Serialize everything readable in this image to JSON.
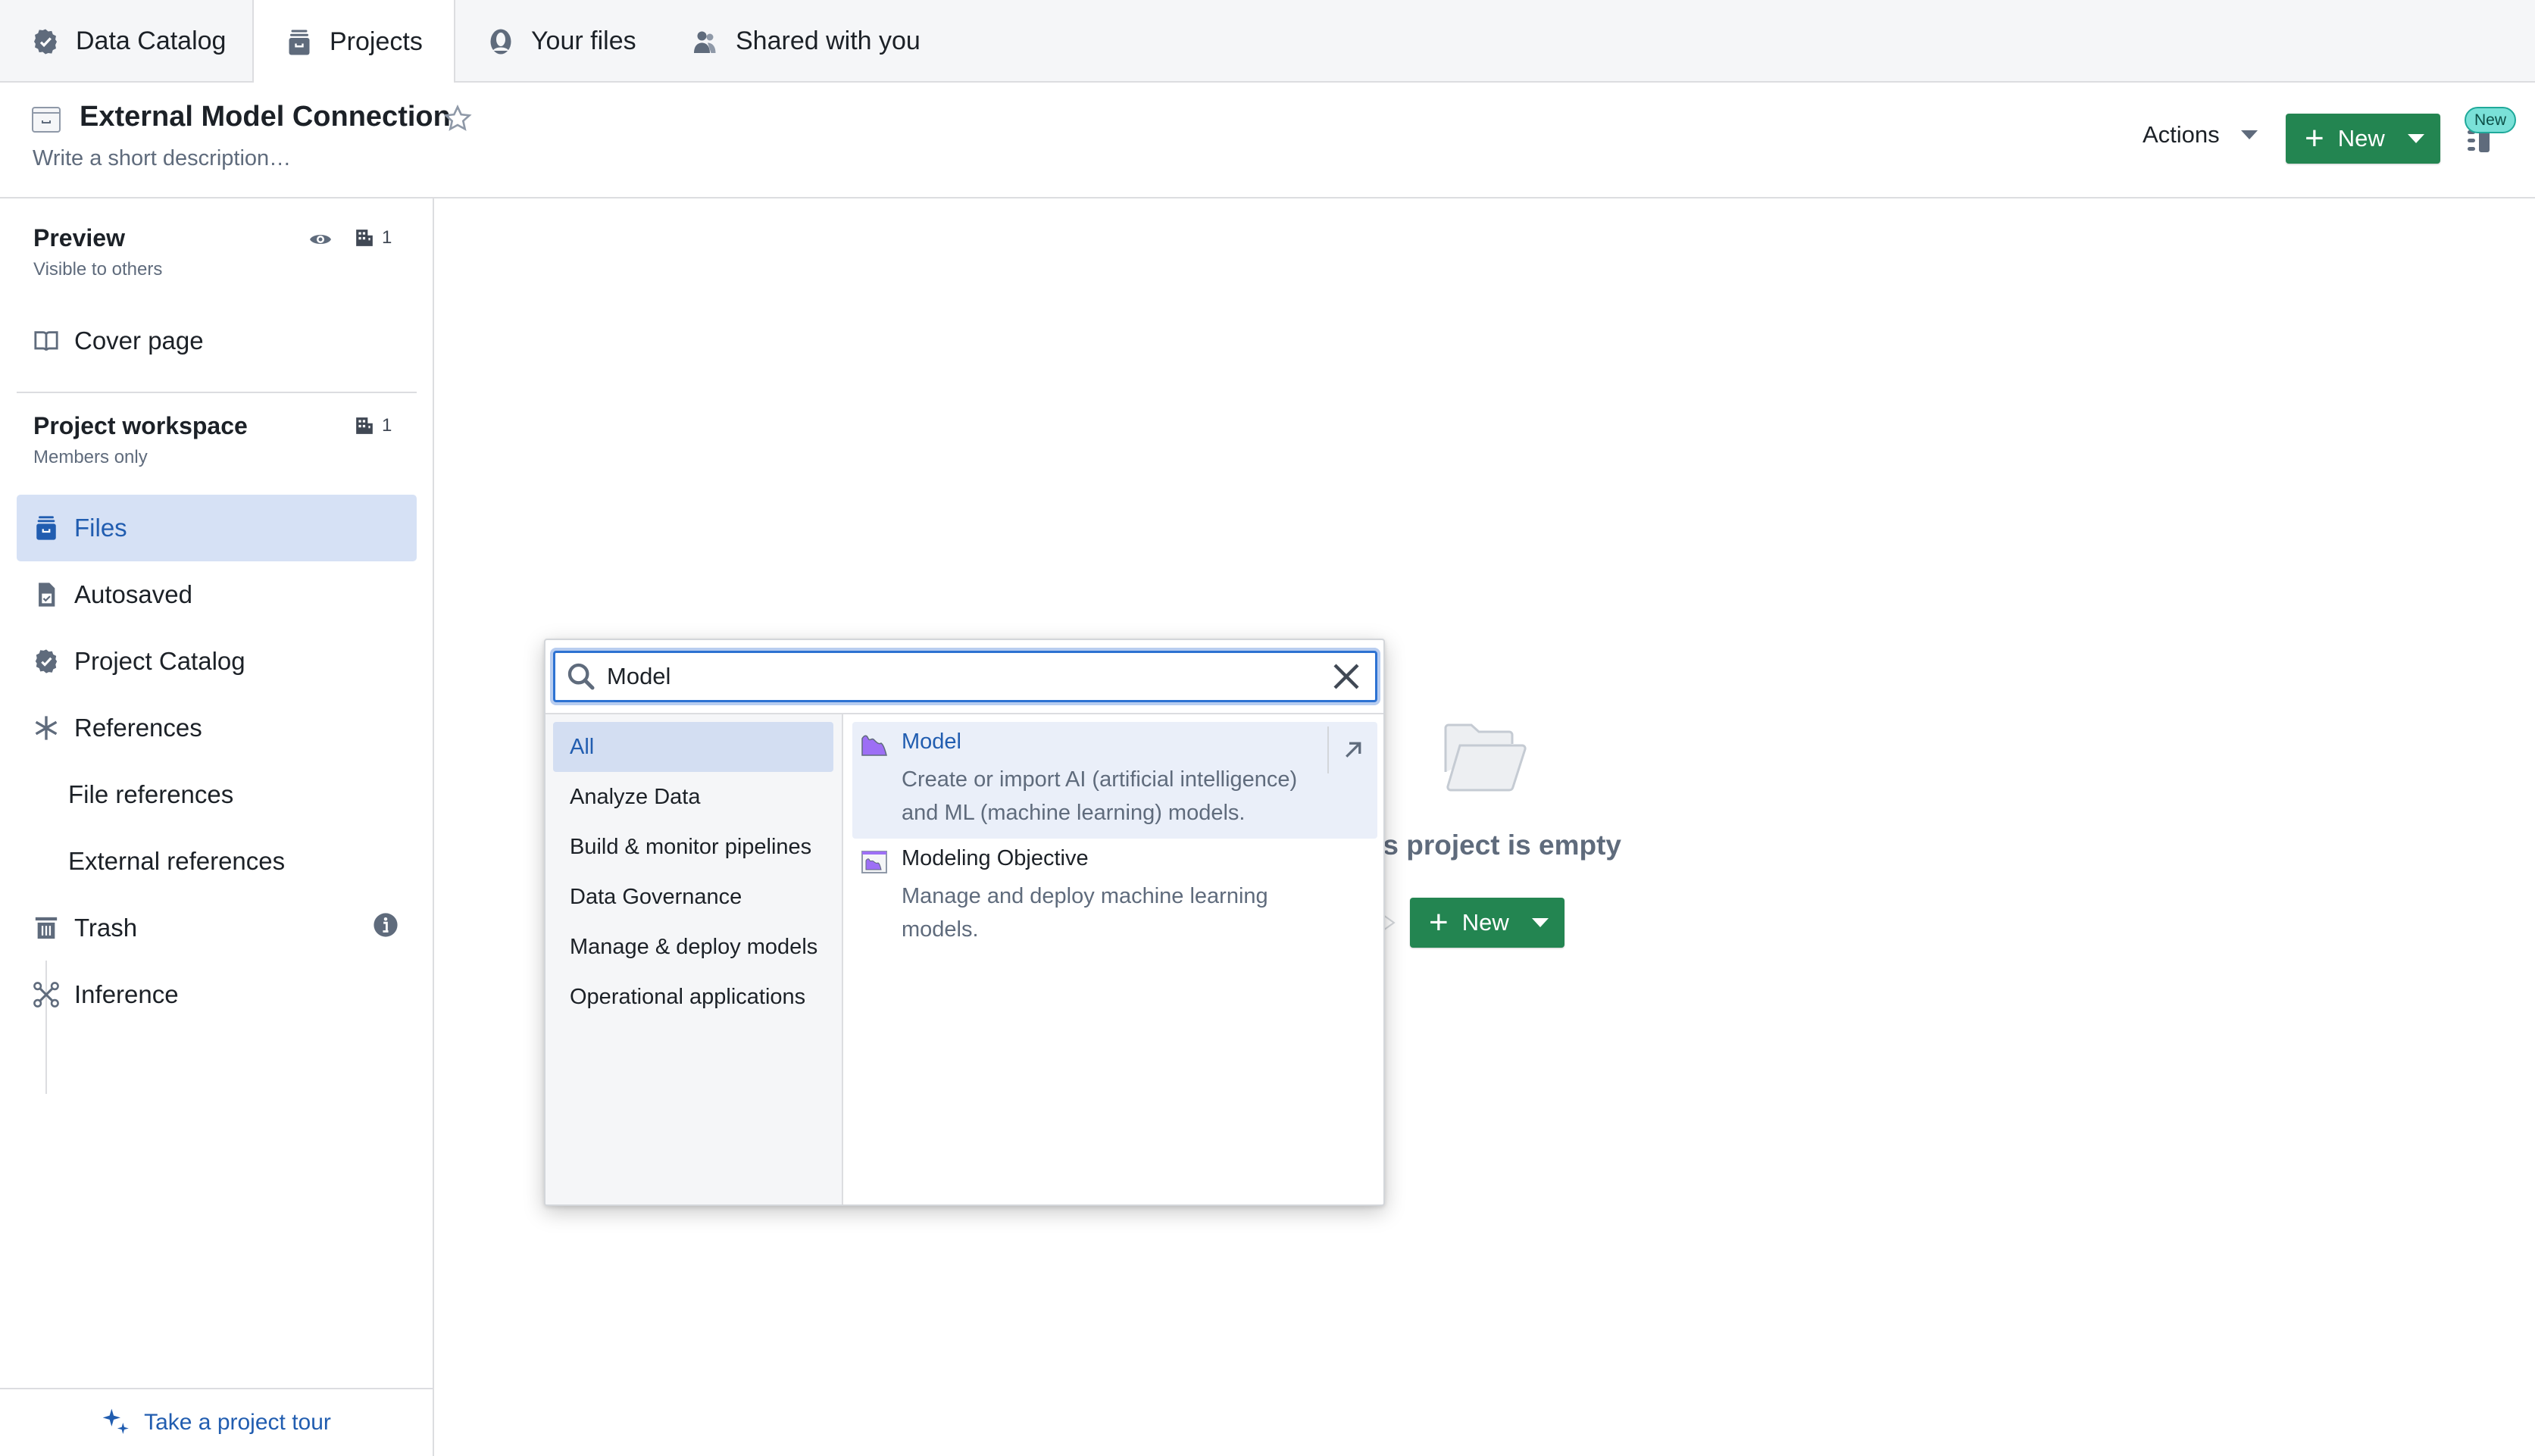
{
  "tabs": [
    {
      "label": "Data Catalog",
      "icon": "verified-badge-icon",
      "active": false
    },
    {
      "label": "Projects",
      "icon": "archive-box-icon",
      "active": true
    },
    {
      "label": "Your files",
      "icon": "user-icon",
      "active": false
    },
    {
      "label": "Shared with you",
      "icon": "people-icon",
      "active": false
    }
  ],
  "header": {
    "title": "External Model Connection",
    "description_placeholder": "Write a short description…",
    "actions_label": "Actions",
    "new_label": "New",
    "new_badge": "New"
  },
  "sidebar": {
    "preview": {
      "title": "Preview",
      "subtitle": "Visible to others",
      "org_count": "1"
    },
    "cover_page": "Cover page",
    "workspace": {
      "title": "Project workspace",
      "subtitle": "Members only",
      "org_count": "1"
    },
    "items": [
      {
        "label": "Files",
        "icon": "archive-box-icon",
        "active": true
      },
      {
        "label": "Autosaved",
        "icon": "document-check-icon"
      },
      {
        "label": "Project Catalog",
        "icon": "verified-badge-icon"
      },
      {
        "label": "References",
        "icon": "asterisk-icon"
      },
      {
        "label": "File references"
      },
      {
        "label": "External references"
      },
      {
        "label": "Trash",
        "icon": "trash-icon"
      },
      {
        "label": "Inference",
        "icon": "graph-nodes-icon"
      }
    ],
    "tour_label": "Take a project tour"
  },
  "main": {
    "empty_text": "is project is empty",
    "new_label": "New"
  },
  "popup": {
    "search_value": "Model",
    "categories": [
      {
        "label": "All",
        "active": true
      },
      {
        "label": "Analyze Data"
      },
      {
        "label": "Build & monitor pipelines"
      },
      {
        "label": "Data Governance"
      },
      {
        "label": "Manage & deploy models"
      },
      {
        "label": "Operational applications"
      }
    ],
    "results": [
      {
        "title": "Model",
        "description": "Create or import AI (artificial intelligence) and ML (machine learning) models.",
        "highlighted": true
      },
      {
        "title": "Modeling Objective",
        "description": "Manage and deploy machine learning models.",
        "highlighted": false
      }
    ]
  },
  "colors": {
    "accent_blue": "#215db0",
    "primary_green": "#238551",
    "badge_teal": "#7ae1d8",
    "model_purple": "#9d6ff5"
  }
}
